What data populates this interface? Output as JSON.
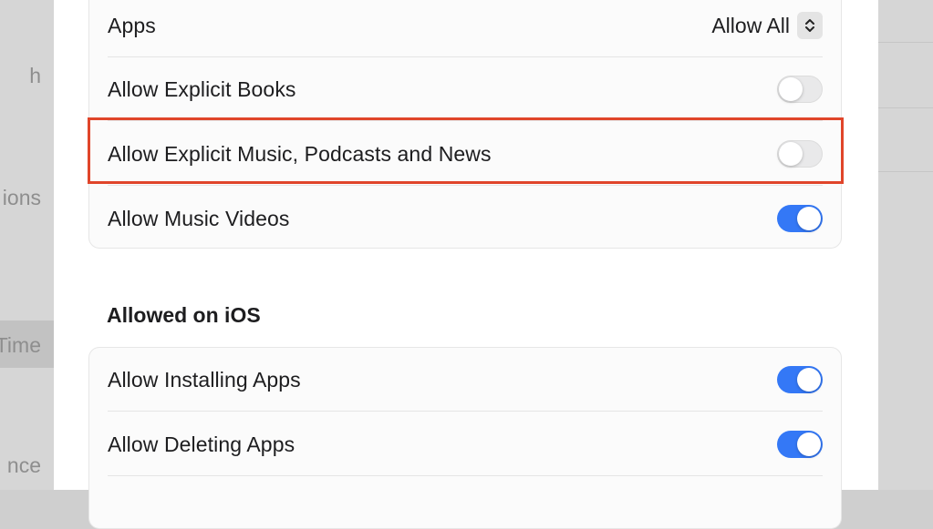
{
  "background": {
    "left_fragments": [
      "h",
      "ions",
      "Time",
      "nce"
    ]
  },
  "content_group": {
    "rows": [
      {
        "label": "Apps",
        "control": "popup",
        "value": "Allow All"
      },
      {
        "label": "Allow Explicit Books",
        "control": "toggle",
        "on": false
      },
      {
        "label": "Allow Explicit Music, Podcasts and News",
        "control": "toggle",
        "on": false,
        "highlighted": true
      },
      {
        "label": "Allow Music Videos",
        "control": "toggle",
        "on": true
      }
    ]
  },
  "ios_section": {
    "title": "Allowed on iOS",
    "rows": [
      {
        "label": "Allow Installing Apps",
        "control": "toggle",
        "on": true
      },
      {
        "label": "Allow Deleting Apps",
        "control": "toggle",
        "on": true
      }
    ]
  },
  "colors": {
    "toggle_on": "#3478f6",
    "toggle_off": "#e9e9ea",
    "highlight_border": "#e0452a"
  },
  "icons": {
    "popup_stepper": "chevron-up-down-icon"
  }
}
